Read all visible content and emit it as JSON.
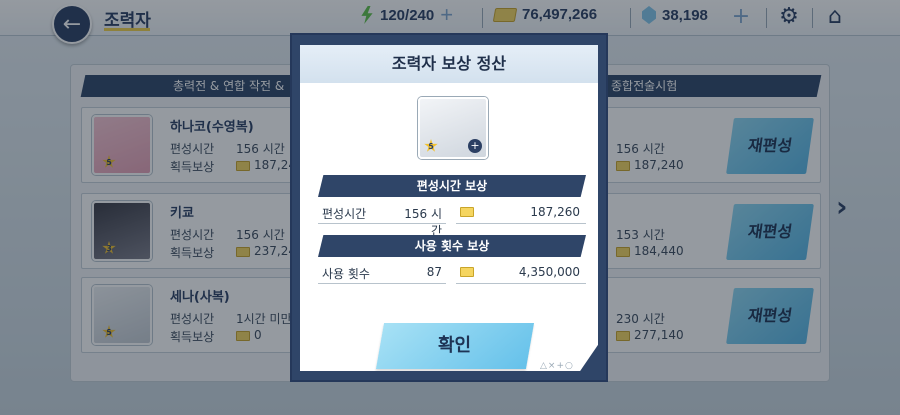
{
  "header": {
    "title": "조력자",
    "ap": "120/240",
    "credits": "76,497,266",
    "gems": "38,198"
  },
  "sections": {
    "left": "총력전 & 연합 작전 &",
    "right": "종합전술시험"
  },
  "rows": [
    {
      "name": "하나코(수영복)",
      "star": "5",
      "label_time": "편성시간",
      "time": "156 시간",
      "label_reward": "획득보상",
      "reward": "187,24",
      "right_time": "156 시간",
      "right_reward": "187,240",
      "button": "재편성"
    },
    {
      "name": "키쿄",
      "star": "3",
      "label_time": "편성시간",
      "time": "156 시간",
      "label_reward": "획득보상",
      "reward": "237,24",
      "right_time": "153 시간",
      "right_reward": "184,440",
      "button": "재편성"
    },
    {
      "name": "세나(사복)",
      "star": "5",
      "label_time": "편성시간",
      "time": "1시간 미만",
      "label_reward": "획득보상",
      "reward": "0",
      "right_time": "230 시간",
      "right_reward": "277,140",
      "button": "재편성"
    }
  ],
  "modal": {
    "title": "조력자 보상 정산",
    "star": "5",
    "section1_title": "편성시간 보상",
    "time_label": "편성시간",
    "time_value": "156 시간",
    "time_reward": "187,260",
    "section2_title": "사용 횟수 보상",
    "count_label": "사용 횟수",
    "count_value": "87",
    "count_reward": "4,350,000",
    "confirm": "확인",
    "deco": "△×+○"
  }
}
